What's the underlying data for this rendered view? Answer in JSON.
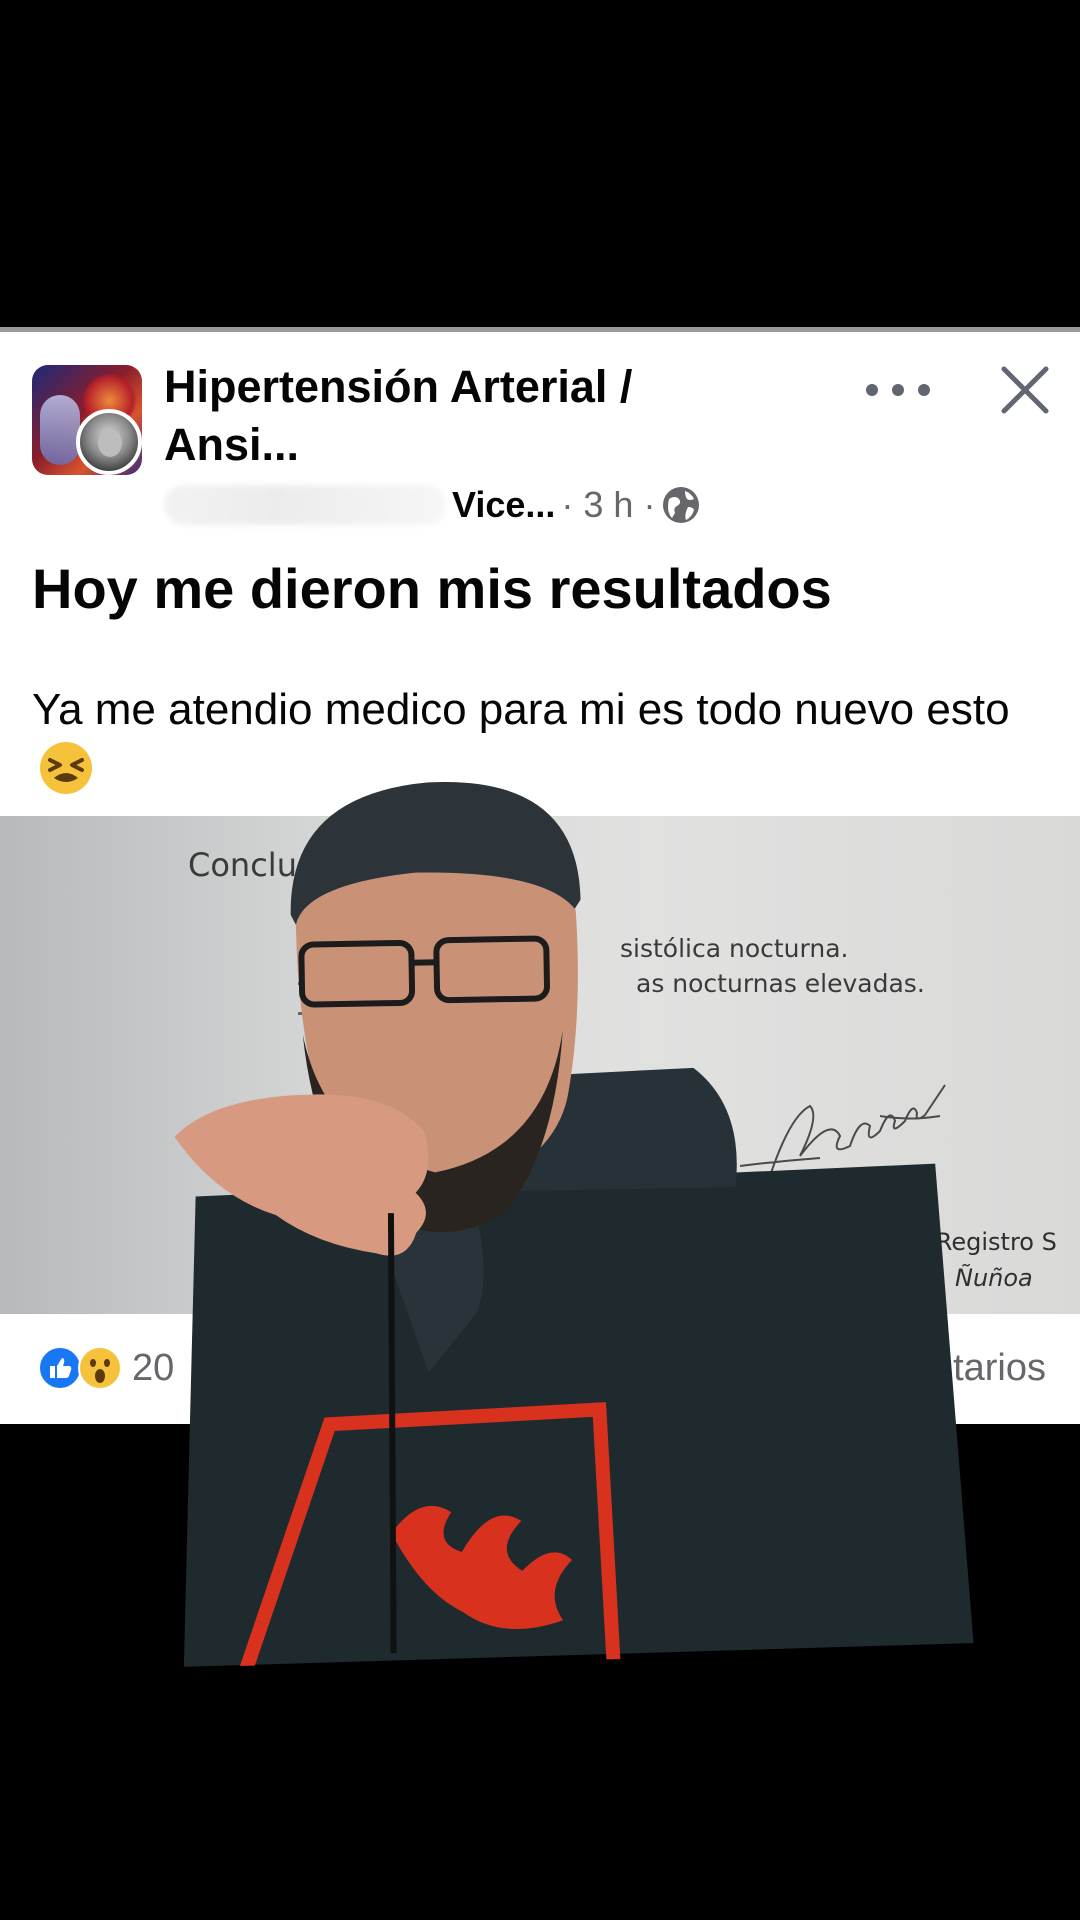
{
  "post": {
    "group_name": "Hipertensión Arterial / Ansi...",
    "author_short": "Vice...",
    "time": "· 3 h ·",
    "title": "Hoy me dieron mis resultados",
    "body": "Ya me atendio medico para mi es todo nuevo esto"
  },
  "photo_text": {
    "heading": "Conclusió",
    "line1": "sistólica nocturna.",
    "line2": "as  nocturnas elevadas.",
    "line3": "diólogo - Registro S",
    "line4": "Ñuñoa"
  },
  "footer": {
    "reaction_count": "20",
    "comments_label": "tarios"
  },
  "colors": {
    "like_blue": "#1877f2",
    "text_primary": "#050505",
    "text_secondary": "#65676b"
  },
  "icons": [
    "more-icon",
    "close-icon",
    "globe-icon",
    "like-icon",
    "wow-icon",
    "tired-face-icon"
  ]
}
